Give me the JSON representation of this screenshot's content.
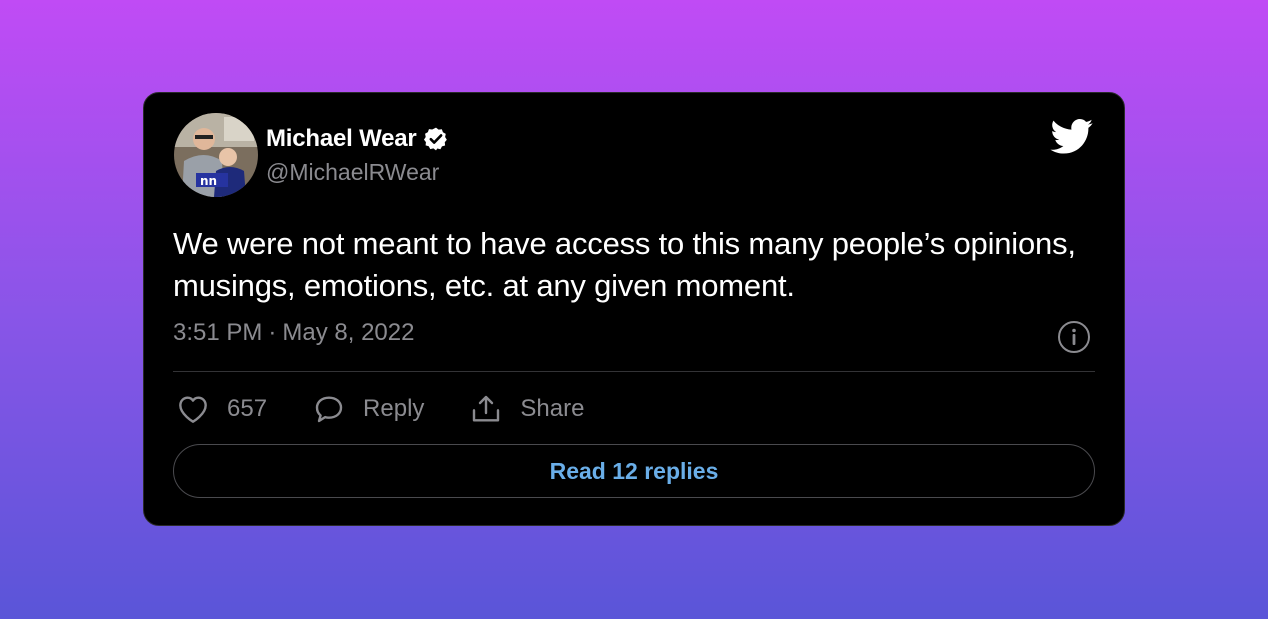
{
  "tweet": {
    "author_name": "Michael Wear",
    "author_handle": "@MichaelRWear",
    "text": "We were not meant to have access to this many people’s opinions, musings, emotions, etc. at any given moment.",
    "time": "3:51 PM",
    "separator": "·",
    "date": "May 8, 2022",
    "like_count": "657",
    "reply_label": "Reply",
    "share_label": "Share",
    "read_replies_label": "Read 12 replies"
  },
  "icons": {
    "verified": "verified-badge-icon",
    "brand": "twitter-bird-icon",
    "info": "info-icon",
    "like": "heart-icon",
    "reply": "speech-bubble-icon",
    "share": "share-upload-icon"
  },
  "colors": {
    "card_bg": "#000000",
    "text_primary": "#ffffff",
    "text_secondary": "#8b8b90",
    "link_blue": "#6aaee8",
    "bg_gradient_top": "#c04bf5",
    "bg_gradient_bottom": "#5a55d8"
  }
}
